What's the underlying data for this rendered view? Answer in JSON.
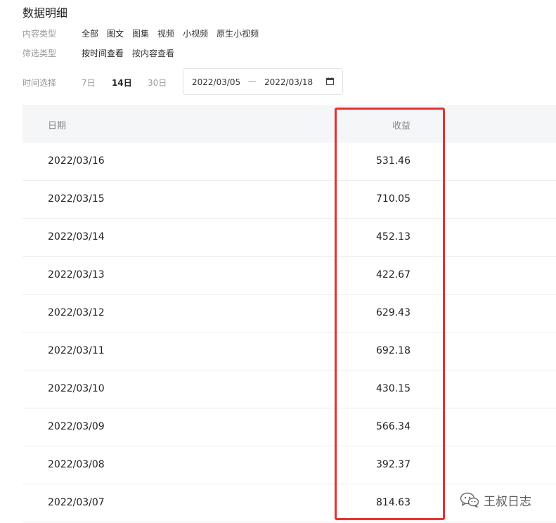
{
  "page_title": "数据明细",
  "filters": {
    "content_type": {
      "label": "内容类型",
      "options": [
        "全部",
        "图文",
        "图集",
        "视频",
        "小视频",
        "原生小视频"
      ],
      "selected": "图文"
    },
    "filter_type": {
      "label": "筛选类型",
      "options": [
        "按时间查看",
        "按内容查看"
      ],
      "selected": "按时间查看"
    }
  },
  "time_select": {
    "label": "时间选择",
    "options": [
      "7日",
      "14日",
      "30日"
    ],
    "selected": "14日",
    "date_range": {
      "start": "2022/03/05",
      "separator": "—",
      "end": "2022/03/18",
      "icon": "calendar-icon"
    }
  },
  "table": {
    "columns": [
      "日期",
      "收益"
    ],
    "rows": [
      {
        "date": "2022/03/16",
        "earnings": "531.46"
      },
      {
        "date": "2022/03/15",
        "earnings": "710.05"
      },
      {
        "date": "2022/03/14",
        "earnings": "452.13"
      },
      {
        "date": "2022/03/13",
        "earnings": "422.67"
      },
      {
        "date": "2022/03/12",
        "earnings": "629.43"
      },
      {
        "date": "2022/03/11",
        "earnings": "692.18"
      },
      {
        "date": "2022/03/10",
        "earnings": "430.15"
      },
      {
        "date": "2022/03/09",
        "earnings": "566.34"
      },
      {
        "date": "2022/03/08",
        "earnings": "392.37"
      },
      {
        "date": "2022/03/07",
        "earnings": "814.63"
      }
    ]
  },
  "highlight": {
    "color": "#e5312f"
  },
  "watermark": {
    "text": "王叔日志",
    "icon": "wechat-icon"
  }
}
